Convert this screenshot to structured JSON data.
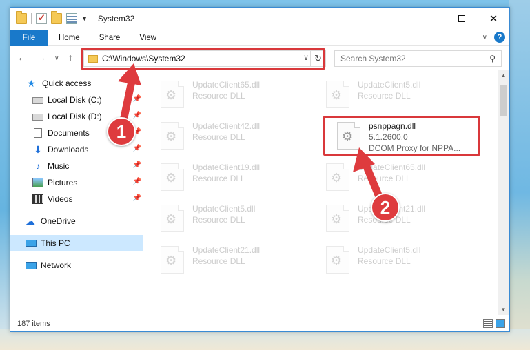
{
  "window": {
    "title": "System32"
  },
  "ribbon": {
    "tabs": [
      "File",
      "Home",
      "Share",
      "View"
    ]
  },
  "address": {
    "path": "C:\\Windows\\System32"
  },
  "search": {
    "placeholder": "Search System32"
  },
  "sidebar": {
    "items": [
      {
        "label": "Quick access",
        "icon": "star-icon"
      },
      {
        "label": "Local Disk (C:)",
        "icon": "drive-icon",
        "pinned": true
      },
      {
        "label": "Local Disk (D:)",
        "icon": "drive-icon",
        "pinned": true
      },
      {
        "label": "Documents",
        "icon": "documents-icon",
        "pinned": true
      },
      {
        "label": "Downloads",
        "icon": "downloads-icon",
        "pinned": true
      },
      {
        "label": "Music",
        "icon": "music-icon",
        "pinned": true
      },
      {
        "label": "Pictures",
        "icon": "pictures-icon",
        "pinned": true
      },
      {
        "label": "Videos",
        "icon": "videos-icon",
        "pinned": true
      },
      {
        "label": "OneDrive",
        "icon": "onedrive-icon"
      },
      {
        "label": "This PC",
        "icon": "computer-icon",
        "selected": true
      },
      {
        "label": "Network",
        "icon": "network-icon"
      }
    ]
  },
  "files": [
    {
      "name": "UpdateClient65.dll",
      "desc": "Resource DLL"
    },
    {
      "name": "UpdateClient5.dll",
      "desc": "Resource DLL"
    },
    {
      "name": "UpdateClient42.dll",
      "desc": "Resource DLL"
    },
    {
      "name": "psnppagn.dll",
      "desc": "5.1.2600.0",
      "desc2": "DCOM Proxy for NPPA...",
      "highlighted": true
    },
    {
      "name": "UpdateClient19.dll",
      "desc": "Resource DLL"
    },
    {
      "name": "UpdateClient65.dll",
      "desc": "Resource DLL"
    },
    {
      "name": "UpdateClient5.dll",
      "desc": "Resource DLL"
    },
    {
      "name": "UpdateClient21.dll",
      "desc": "Resource DLL"
    },
    {
      "name": "UpdateClient21.dll",
      "desc": "Resource DLL"
    },
    {
      "name": "UpdateClient5.dll",
      "desc": "Resource DLL"
    }
  ],
  "status": {
    "count": "187 items"
  },
  "annotations": {
    "badge1": "1",
    "badge2": "2",
    "color": "#de3b3e"
  }
}
